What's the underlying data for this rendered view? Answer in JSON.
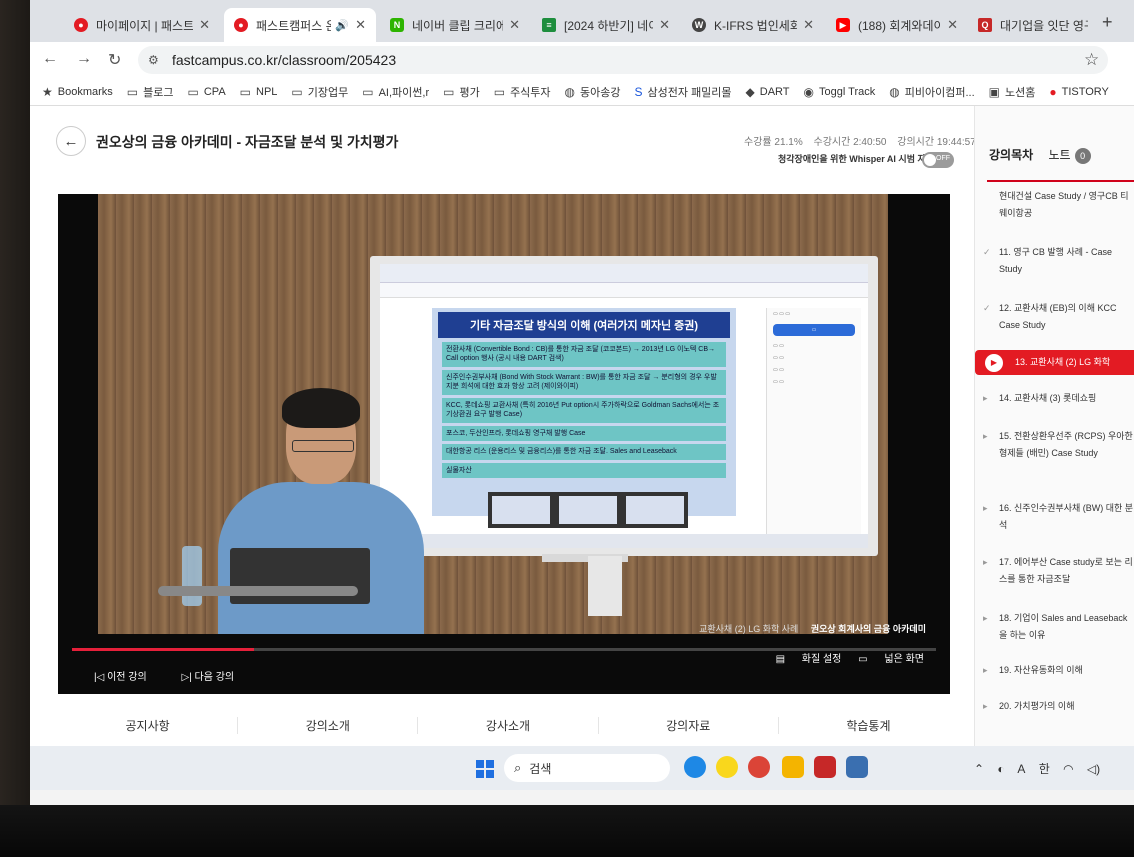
{
  "tabs": [
    {
      "label": "마이페이지 | 패스트",
      "active": false,
      "icon": "fastcampus-icon"
    },
    {
      "label": "패스트캠퍼스 온",
      "active": true,
      "icon": "fastcampus-icon"
    },
    {
      "label": "네이버 클립 크리에이",
      "active": false,
      "icon": "naver-icon"
    },
    {
      "label": "[2024 하반기] 네이버",
      "active": false,
      "icon": "doc-icon"
    },
    {
      "label": "K-IFRS 법인세회계",
      "active": false,
      "icon": "wordpress-icon"
    },
    {
      "label": "(188) 회계와데이터",
      "active": false,
      "icon": "youtube-icon"
    },
    {
      "label": "대기업을 잇단 영구",
      "active": false,
      "icon": "q-icon"
    }
  ],
  "url": "fastcampus.co.kr/classroom/205423",
  "bookmarks": [
    "Bookmarks",
    "블로그",
    "CPA",
    "NPL",
    "기장업무",
    "AI,파이썬,r",
    "평가",
    "주식투자",
    "동아송강",
    "삼성전자 패밀리몰",
    "DART",
    "Toggl Track",
    "피비아이컴퍼...",
    "노션홈",
    "TISTORY"
  ],
  "course": {
    "title": "권오상의 금융 아카데미 - 자금조달 분석 및 가치평가",
    "progress_text": "수강률 21.1%",
    "watch_time": "수강시간 2:40:50",
    "lecture_time": "강의시간 19:44:57",
    "whisper_label": "청각장애인을 위한 Whisper AI 시범 자막",
    "toggle_state": "OFF",
    "progress_fraction": 0.211
  },
  "slide": {
    "title": "기타 자금조달 방식의 이해 (여러가지 메자닌 증권)",
    "items": [
      "전환사채 (Convertible Bond : CB)를 통한 자금 조달 (코코본드) → 2013년 LG 이노텍 CB→ Call option 행사 (공시 내용 DART 검색)",
      "신주인수권부사채 (Bond With Stock Warrant : BW)를 통한 자금 조달 → 분리형의 경우 우발지분 희석에 대한 효과 항상 고려 (제이와이피)",
      "KCC, 롯데쇼핑 교환사채 (특히 2016년 Put option시 주가하락으로 Goldman Sachs에서는 조기상환권 요구 발행 Case)",
      "포스코, 두산인프라, 롯데쇼핑 영구채 발행 Case",
      "대한항공 리스 (운용리스 및 금융리스)를 통한 자금 조달. Sales and Leaseback",
      "실물자산"
    ]
  },
  "video": {
    "caption_lecture": "교환사채 (2) LG 화학 사례",
    "caption_brand": "권오상 회계사의 금융 아카데미",
    "prev": "이전 강의",
    "next": "다음 강의",
    "quality": "화질 설정",
    "wide": "넓은 화면"
  },
  "bottom_tabs": [
    "공지사항",
    "강의소개",
    "강사소개",
    "강의자료",
    "학습통계"
  ],
  "side": {
    "tab_toc": "강의목차",
    "tab_note": "노트",
    "note_count": "0",
    "items": [
      {
        "text": "현대건설 Case Study / 영구CB 티웨이항공",
        "mark": "",
        "active": false
      },
      {
        "text": "11. 영구 CB 발행 사례 - Case Study",
        "mark": "✓",
        "active": false
      },
      {
        "text": "12. 교환사채 (EB)의 이해 KCC Case Study",
        "mark": "✓",
        "active": false
      },
      {
        "text": "13. 교환사채 (2) LG 화학",
        "mark": "",
        "active": true
      },
      {
        "text": "14. 교환사채 (3) 롯데쇼핑",
        "mark": "▸",
        "active": false
      },
      {
        "text": "15. 전환상환우선주 (RCPS) 우아한형제들 (배민) Case Study",
        "mark": "▸",
        "active": false
      },
      {
        "text": "16. 신주인수권부사채 (BW) 대한 분석",
        "mark": "▸",
        "active": false
      },
      {
        "text": "17. 에어부산 Case study로 보는 리스를 통한 자금조달",
        "mark": "▸",
        "active": false
      },
      {
        "text": "18. 기업이 Sales and Leaseback을 하는 이유",
        "mark": "▸",
        "active": false
      },
      {
        "text": "19. 자산유동화의 이해",
        "mark": "▸",
        "active": false
      },
      {
        "text": "20. 가치평가의 이해",
        "mark": "▸",
        "active": false
      }
    ]
  },
  "taskbar": {
    "search_label": "검색",
    "tray_lang": "A",
    "tray_ime": "한"
  }
}
